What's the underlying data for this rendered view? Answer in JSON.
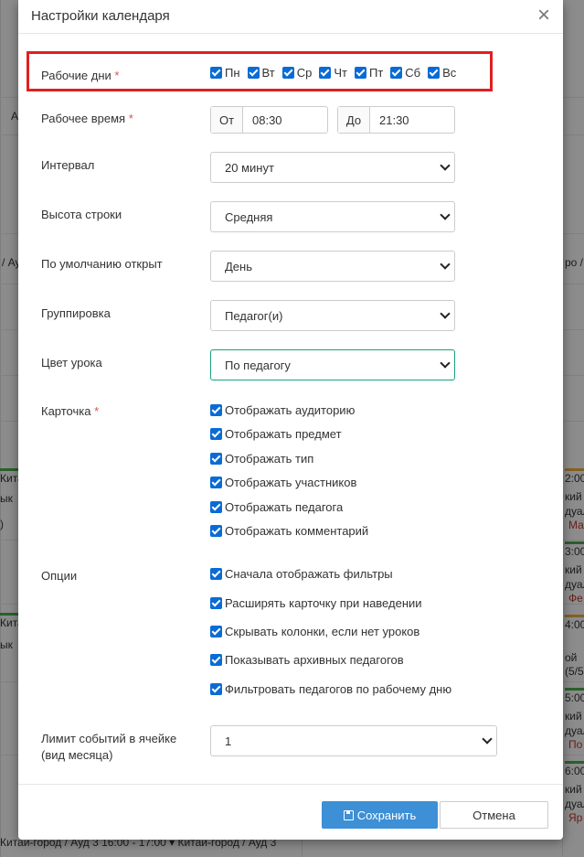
{
  "modal": {
    "title": "Настройки календаря",
    "close": "×"
  },
  "work_days": {
    "label": "Рабочие дни",
    "required": "*",
    "days": [
      "Пн",
      "Вт",
      "Ср",
      "Чт",
      "Пт",
      "Сб",
      "Вс"
    ]
  },
  "work_time": {
    "label": "Рабочее время",
    "required": "*",
    "from_label": "От",
    "from_value": "08:30",
    "to_label": "До",
    "to_value": "21:30"
  },
  "interval": {
    "label": "Интервал",
    "value": "20 минут"
  },
  "row_height": {
    "label": "Высота строки",
    "value": "Средняя"
  },
  "default_open": {
    "label": "По умолчанию открыт",
    "value": "День"
  },
  "grouping": {
    "label": "Группировка",
    "value": "Педагог(и)"
  },
  "lesson_color": {
    "label": "Цвет урока",
    "value": "По педагогу"
  },
  "card": {
    "label": "Карточка",
    "required": "*",
    "options": [
      "Отображать аудиторию",
      "Отображать предмет",
      "Отображать тип",
      "Отображать участников",
      "Отображать педагога",
      "Отображать комментарий"
    ]
  },
  "options": {
    "label": "Опции",
    "items": [
      "Сначала отображать фильтры",
      "Расширять карточку при наведении",
      "Скрывать колонки, если нет уроков",
      "Показывать архивных педагогов",
      "Фильтровать педагогов по рабочему дню"
    ]
  },
  "event_limit": {
    "label_line1": "Лимит событий в ячейке",
    "label_line2": "(вид месяца)",
    "value": "1"
  },
  "footer": {
    "save_label": "Сохранить",
    "cancel_label": "Отмена"
  },
  "background": {
    "left_cells": [
      "А",
      "/ Ау",
      "Кита",
      "ык",
      ")",
      "Кита",
      "ык"
    ],
    "right_cells": [
      "ро /",
      "2:00",
      "кий",
      "дуал",
      "Ма",
      "3:00",
      "кий",
      "дуал",
      "Фе",
      "4:00",
      "ой",
      "(5/5",
      "5:00",
      "кий",
      "дуал",
      "По",
      "6:00",
      "кий",
      "дуал",
      "Яр"
    ],
    "bottom_text": "Китай-город / Ауд 3   16:00 - 17:00 ▾ Китай-город / Ауд 3"
  }
}
